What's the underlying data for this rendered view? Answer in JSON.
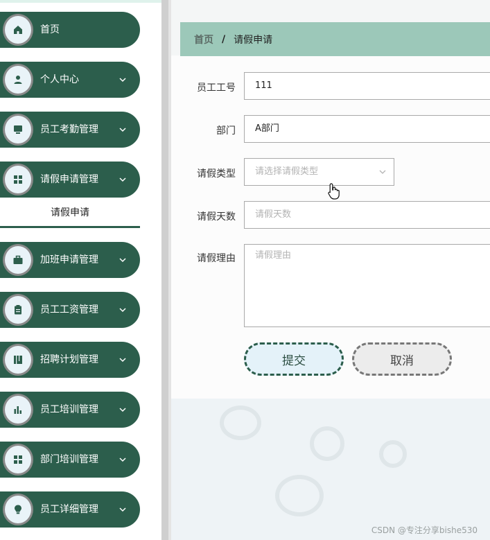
{
  "sidebar": {
    "items": [
      {
        "label": "首页",
        "icon": "home-icon",
        "has_chevron": false
      },
      {
        "label": "个人中心",
        "icon": "user-icon",
        "has_chevron": true
      },
      {
        "label": "员工考勤管理",
        "icon": "desktop-icon",
        "has_chevron": true
      },
      {
        "label": "请假申请管理",
        "icon": "grid-icon",
        "has_chevron": true
      },
      {
        "label": "加班申请管理",
        "icon": "briefcase-icon",
        "has_chevron": true
      },
      {
        "label": "员工工资管理",
        "icon": "clipboard-icon",
        "has_chevron": true
      },
      {
        "label": "招聘计划管理",
        "icon": "book-icon",
        "has_chevron": true
      },
      {
        "label": "员工培训管理",
        "icon": "bar-chart-icon",
        "has_chevron": true
      },
      {
        "label": "部门培训管理",
        "icon": "grid-icon",
        "has_chevron": true
      },
      {
        "label": "员工详细管理",
        "icon": "bulb-icon",
        "has_chevron": true
      }
    ],
    "sub_item": "请假申请"
  },
  "breadcrumb": {
    "home": "首页",
    "separator": "/",
    "current": "请假申请"
  },
  "form": {
    "employee_no": {
      "label": "员工工号",
      "value": "111"
    },
    "department": {
      "label": "部门",
      "value": "A部门"
    },
    "leave_type": {
      "label": "请假类型",
      "placeholder": "请选择请假类型"
    },
    "leave_days": {
      "label": "请假天数",
      "placeholder": "请假天数"
    },
    "leave_reason": {
      "label": "请假理由",
      "placeholder": "请假理由"
    }
  },
  "buttons": {
    "submit": "提交",
    "cancel": "取消"
  },
  "watermark": "CSDN @专注分享bishe530",
  "colors": {
    "nav_bg": "#2c5e4c",
    "breadcrumb_bg": "#9cc8b9",
    "submit_bg": "#e4f2f9",
    "cancel_bg": "#ececec"
  }
}
